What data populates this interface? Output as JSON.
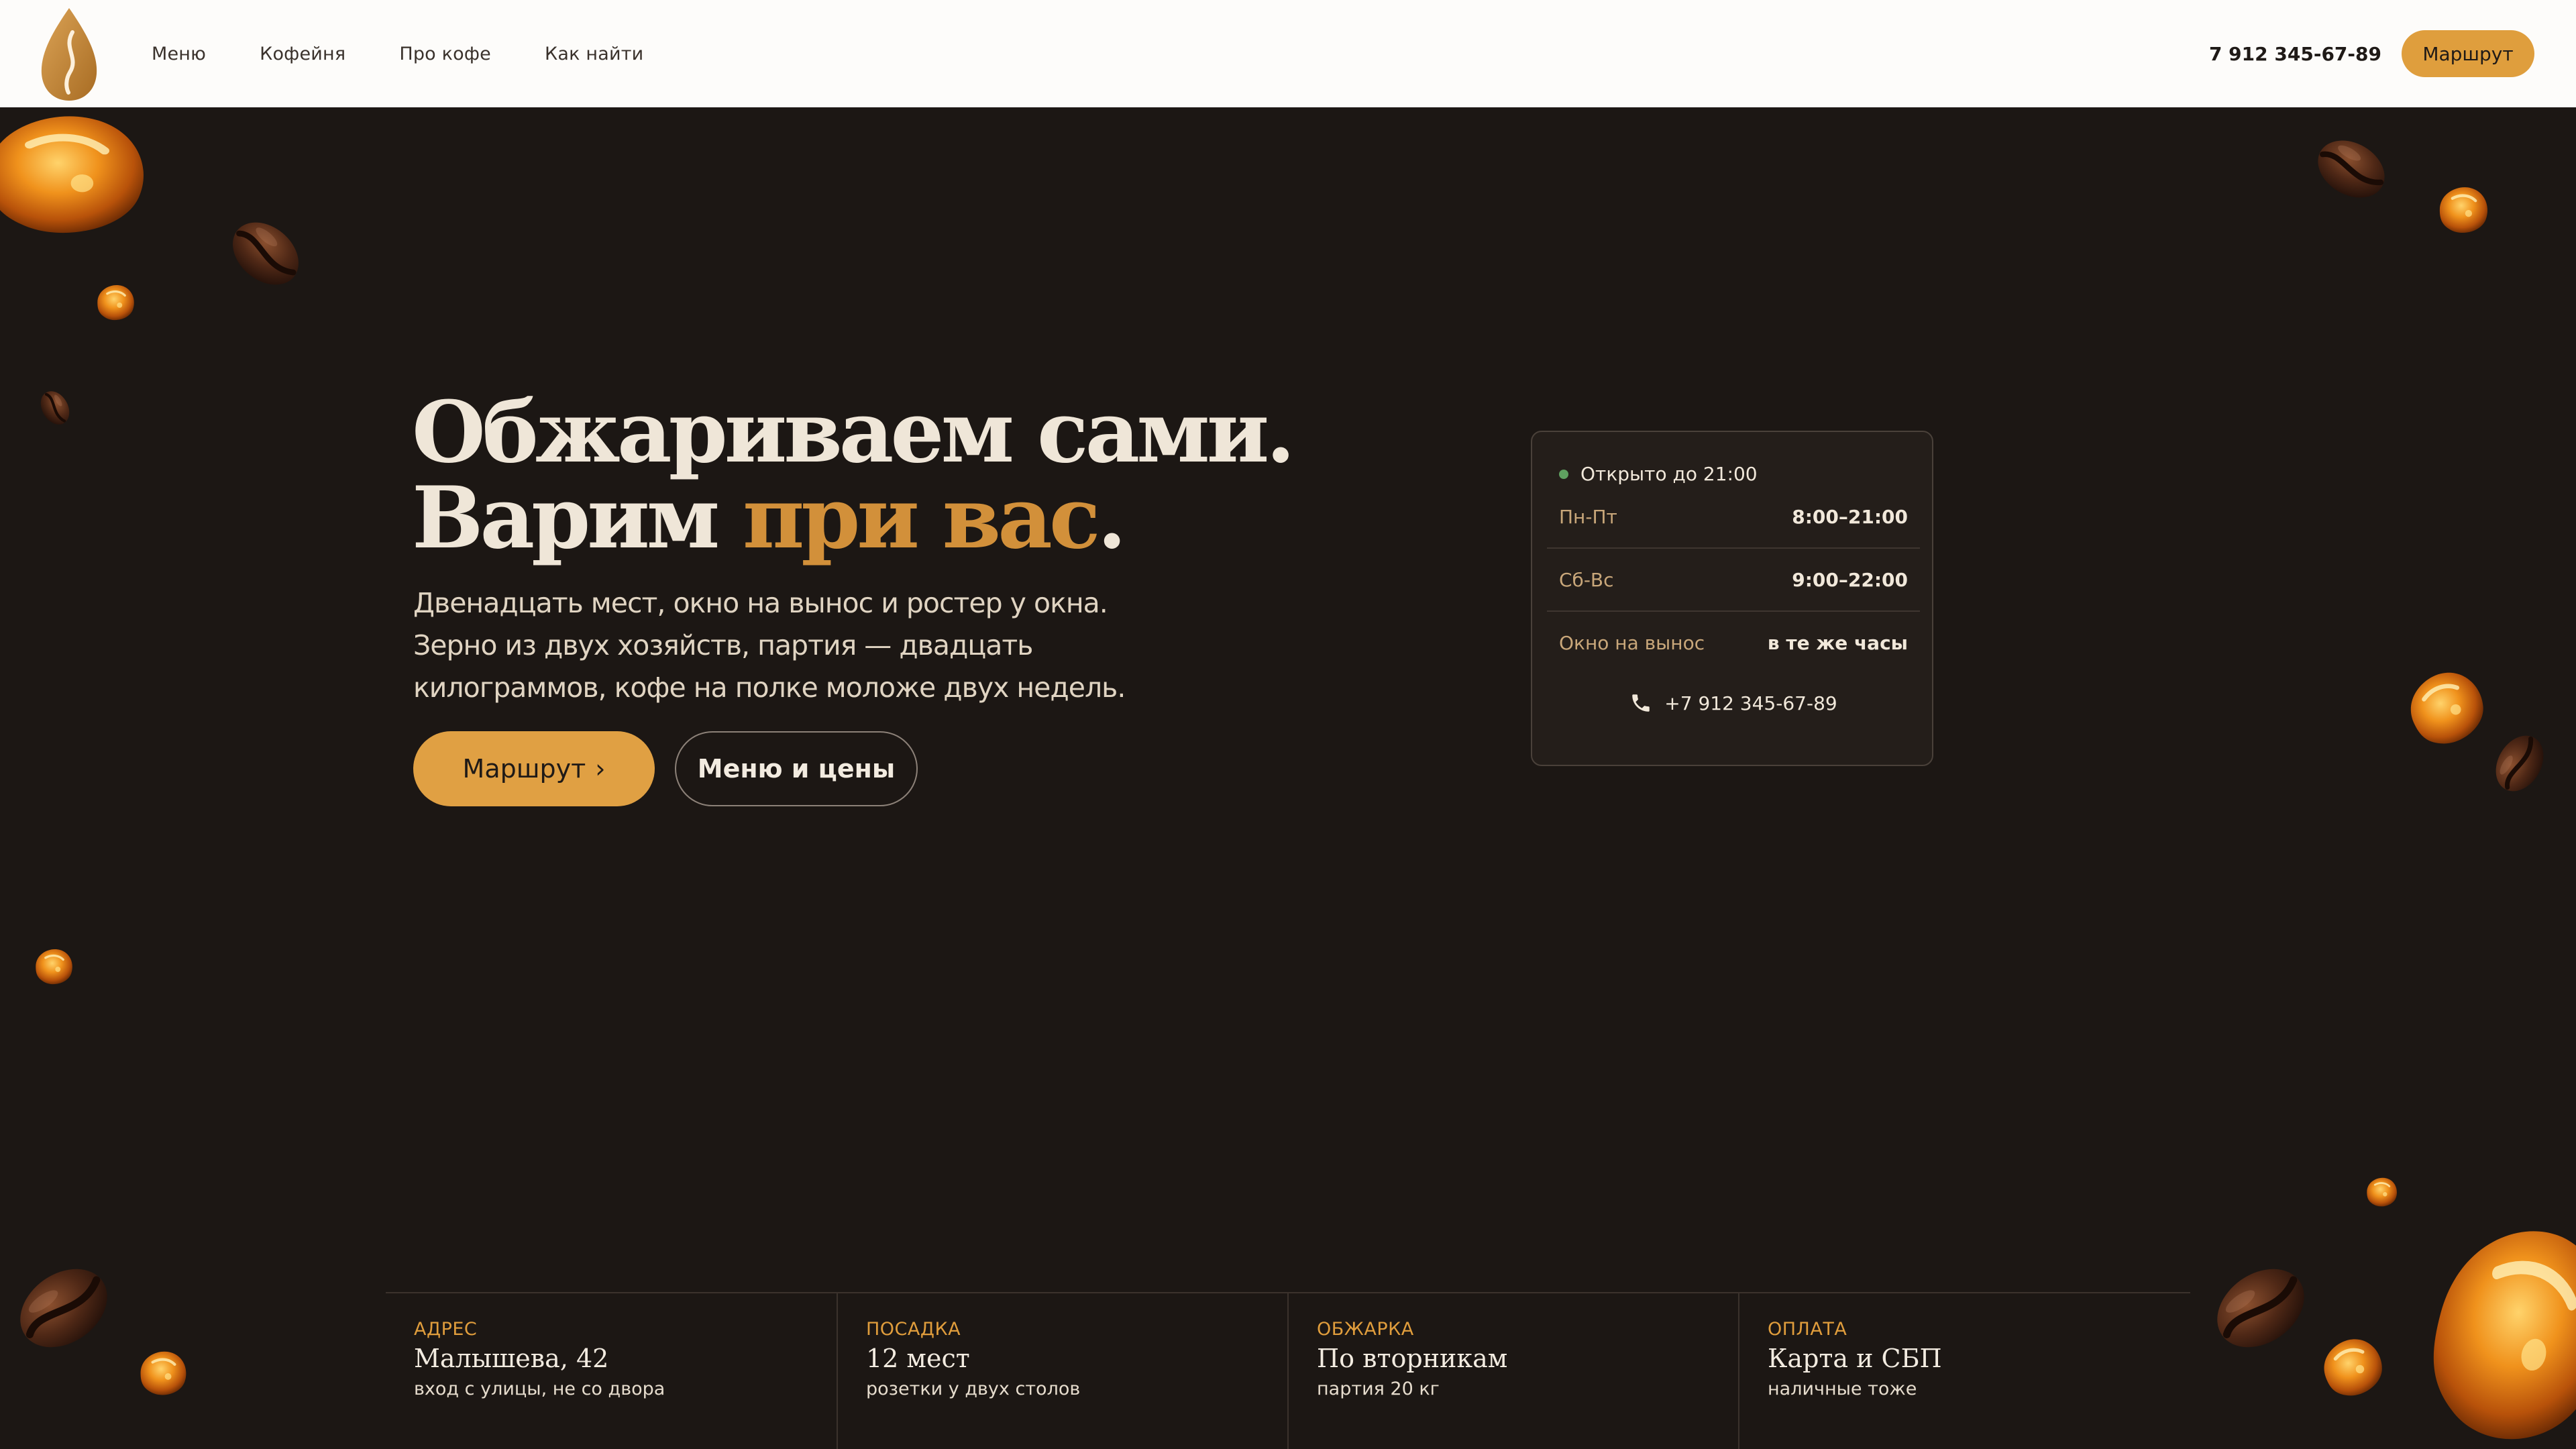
{
  "header": {
    "nav": [
      "Меню",
      "Кофейня",
      "Про кофе",
      "Как найти"
    ],
    "phone": "7 912 345-67-89",
    "route_button": "Маршрут"
  },
  "hero": {
    "title_line1": "Обжариваем сами.",
    "title_line2_prefix": "Варим ",
    "title_line2_accent": "при вас",
    "title_line2_suffix": ".",
    "subtitle_lines": [
      "Двенадцать мест, окно на вынос и ростер у окна.",
      "Зерно из двух хозяйств, партия — двадцать",
      "килограммов, кофе на полке моложе двух недель."
    ],
    "route_button": "Маршрут",
    "route_chevron": "›",
    "menu_button": "Меню и цены"
  },
  "hours": {
    "status": "Открыто до 21:00",
    "rows": [
      {
        "label": "Пн-Пт",
        "value": "8:00–21:00"
      },
      {
        "label": "Сб-Вс",
        "value": "9:00–22:00"
      },
      {
        "label": "Окно на вынос",
        "value": "в те же часы"
      }
    ],
    "phone": "+7 912 345-67-89"
  },
  "info": [
    {
      "key": "АДРЕС",
      "title": "Малышева, 42",
      "sub": "вход с улицы, не со двора"
    },
    {
      "key": "ПОСАДКА",
      "title": "12 мест",
      "sub": "розетки у двух столов"
    },
    {
      "key": "ОБЖАРКА",
      "title": "По вторникам",
      "sub": "партия 20 кг"
    },
    {
      "key": "ОПЛАТА",
      "title": "Карта и СБП",
      "sub": "наличные тоже"
    }
  ],
  "colors": {
    "background": "#1c1714",
    "accent": "#df9e3d",
    "header_bg": "#fdfcfa",
    "status_green": "#5fa160"
  },
  "icons": [
    "logo-drop-icon",
    "phone-icon",
    "coffee-bean-icon",
    "amber-crystal-icon"
  ]
}
